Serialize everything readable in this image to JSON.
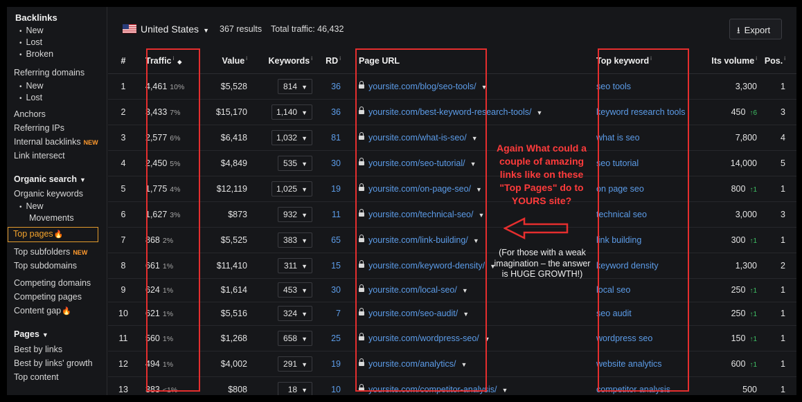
{
  "sidebar": {
    "backlinks": {
      "title": "Backlinks",
      "items": [
        "New",
        "Lost",
        "Broken"
      ]
    },
    "referring_domains": {
      "title": "Referring domains",
      "items": [
        "New",
        "Lost"
      ]
    },
    "anchors": "Anchors",
    "referring_ips": "Referring IPs",
    "internal_backlinks": "Internal backlinks",
    "link_intersect": "Link intersect",
    "new_badge": "NEW",
    "organic": {
      "title": "Organic search",
      "organic_keywords": "Organic keywords",
      "sub_items": [
        "New",
        "Movements"
      ],
      "top_pages": "Top pages",
      "top_subfolders": "Top subfolders",
      "top_subdomains": "Top subdomains",
      "competing_domains": "Competing domains",
      "competing_pages": "Competing pages",
      "content_gap": "Content gap"
    },
    "pages": {
      "title": "Pages",
      "items": [
        "Best by links",
        "Best by links' growth",
        "Top content"
      ]
    }
  },
  "toolbar": {
    "country": "United States",
    "results": "367 results",
    "traffic_total": "Total traffic: 46,432",
    "export_label": "Export"
  },
  "table": {
    "headers": {
      "num": "#",
      "traffic": "Traffic",
      "value": "Value",
      "keywords": "Keywords",
      "rd": "RD",
      "url": "Page URL",
      "top_keyword": "Top keyword",
      "volume": "Its volume",
      "pos": "Pos."
    },
    "rows": [
      {
        "num": "1",
        "traffic": "4,461",
        "pct": "10%",
        "value": "$5,528",
        "keywords": "814",
        "rd": "36",
        "url": "yoursite.com/blog/seo-tools/",
        "top_keyword": "seo tools",
        "volume": "3,300",
        "change": "",
        "pos": "1"
      },
      {
        "num": "2",
        "traffic": "3,433",
        "pct": "7%",
        "value": "$15,170",
        "keywords": "1,140",
        "rd": "36",
        "url": "yoursite.com/best-keyword-research-tools/",
        "top_keyword": "keyword research tools",
        "volume": "450",
        "change": "↑6",
        "pos": "3"
      },
      {
        "num": "3",
        "traffic": "2,577",
        "pct": "6%",
        "value": "$6,418",
        "keywords": "1,032",
        "rd": "81",
        "url": "yoursite.com/what-is-seo/",
        "top_keyword": "what is seo",
        "volume": "7,800",
        "change": "",
        "pos": "4"
      },
      {
        "num": "4",
        "traffic": "2,450",
        "pct": "5%",
        "value": "$4,849",
        "keywords": "535",
        "rd": "30",
        "url": "yoursite.com/seo-tutorial/",
        "top_keyword": "seo tutorial",
        "volume": "14,000",
        "change": "",
        "pos": "5"
      },
      {
        "num": "5",
        "traffic": "1,775",
        "pct": "4%",
        "value": "$12,119",
        "keywords": "1,025",
        "rd": "19",
        "url": "yoursite.com/on-page-seo/",
        "top_keyword": "on page seo",
        "volume": "800",
        "change": "↑1",
        "pos": "1"
      },
      {
        "num": "6",
        "traffic": "1,627",
        "pct": "3%",
        "value": "$873",
        "keywords": "932",
        "rd": "11",
        "url": "yoursite.com/technical-seo/",
        "top_keyword": "technical seo",
        "volume": "3,000",
        "change": "",
        "pos": "3"
      },
      {
        "num": "7",
        "traffic": "868",
        "pct": "2%",
        "value": "$5,525",
        "keywords": "383",
        "rd": "65",
        "url": "yoursite.com/link-building/",
        "top_keyword": "link building",
        "volume": "300",
        "change": "↑1",
        "pos": "1"
      },
      {
        "num": "8",
        "traffic": "661",
        "pct": "1%",
        "value": "$11,410",
        "keywords": "311",
        "rd": "15",
        "url": "yoursite.com/keyword-density/",
        "top_keyword": "keyword density",
        "volume": "1,300",
        "change": "",
        "pos": "2"
      },
      {
        "num": "9",
        "traffic": "624",
        "pct": "1%",
        "value": "$1,614",
        "keywords": "453",
        "rd": "30",
        "url": "yoursite.com/local-seo/",
        "top_keyword": "local seo",
        "volume": "250",
        "change": "↑1",
        "pos": "1"
      },
      {
        "num": "10",
        "traffic": "621",
        "pct": "1%",
        "value": "$5,516",
        "keywords": "324",
        "rd": "7",
        "url": "yoursite.com/seo-audit/",
        "top_keyword": "seo audit",
        "volume": "250",
        "change": "↑1",
        "pos": "1"
      },
      {
        "num": "11",
        "traffic": "560",
        "pct": "1%",
        "value": "$1,268",
        "keywords": "658",
        "rd": "25",
        "url": "yoursite.com/wordpress-seo/",
        "top_keyword": "wordpress seo",
        "volume": "150",
        "change": "↑1",
        "pos": "1"
      },
      {
        "num": "12",
        "traffic": "494",
        "pct": "1%",
        "value": "$4,002",
        "keywords": "291",
        "rd": "19",
        "url": "yoursite.com/analytics/",
        "top_keyword": "website analytics",
        "volume": "600",
        "change": "↑1",
        "pos": "1"
      },
      {
        "num": "13",
        "traffic": "383",
        "pct": "<1%",
        "value": "$808",
        "keywords": "18",
        "rd": "10",
        "url": "yoursite.com/competitor-analysis/",
        "top_keyword": "competitor analysis",
        "volume": "500",
        "change": "",
        "pos": "1"
      }
    ]
  },
  "annotation": {
    "headline": "Again What could a couple of amazing links like on these \"Top Pages\" do to YOURS site?",
    "note": "(For those with a weak imagination – the answer is HUGE GROWTH!)",
    "color": "#e52e2e"
  }
}
